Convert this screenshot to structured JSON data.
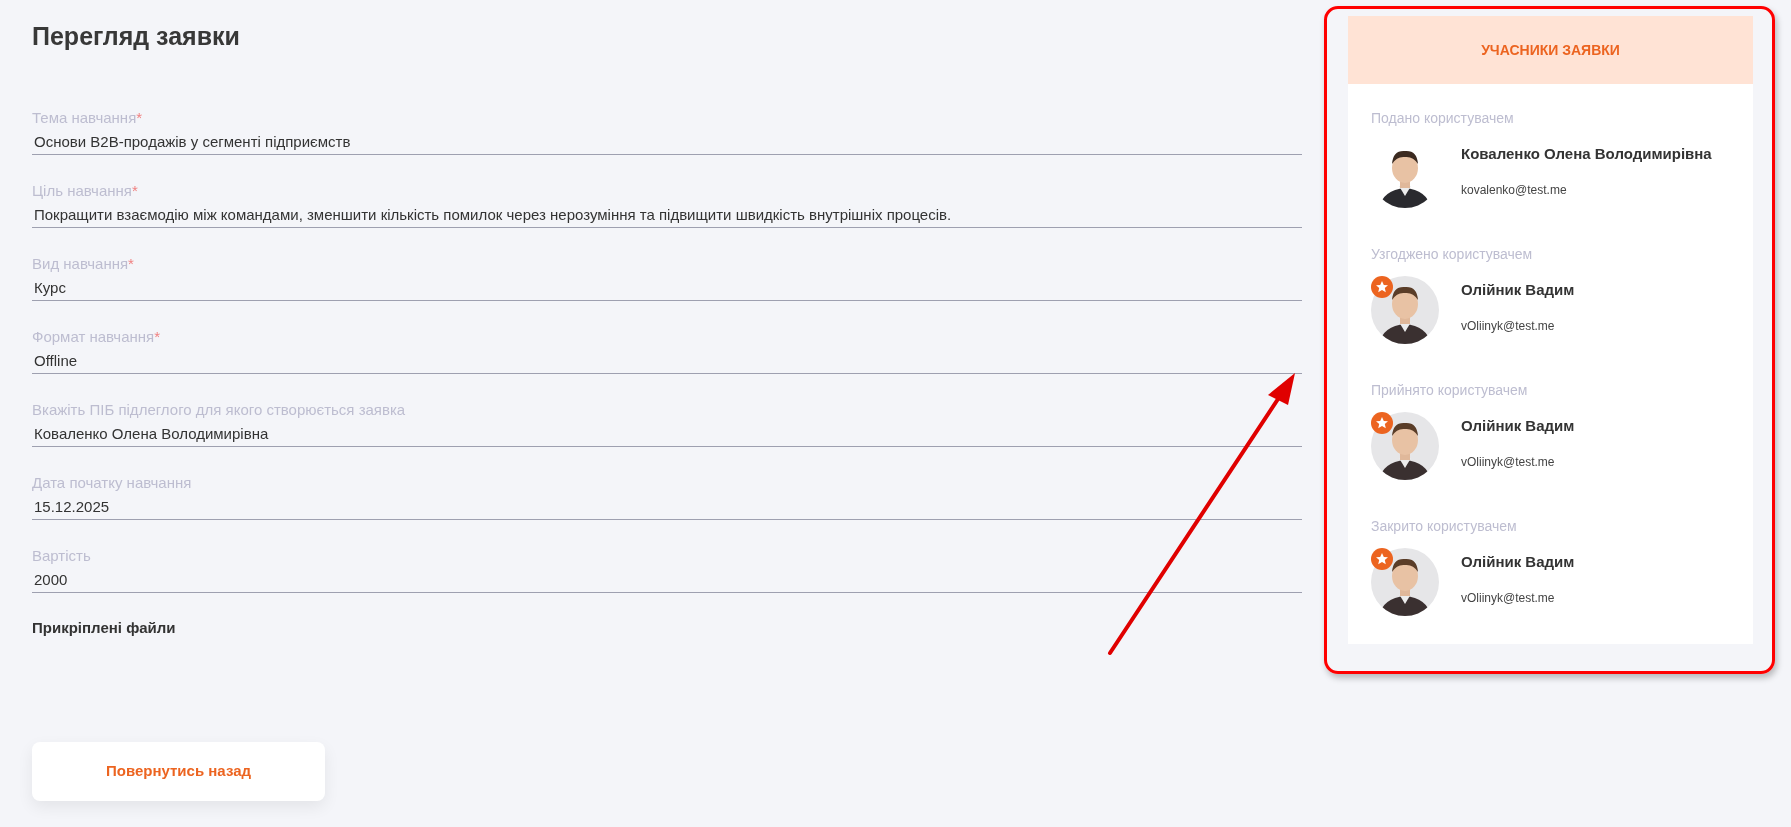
{
  "title": "Перегляд заявки",
  "fields": [
    {
      "label": "Тема навчання",
      "required_mark": "*",
      "value": "Основи B2B-продажів у сегменті підприємств"
    },
    {
      "label": "Ціль навчання",
      "required_mark": "*",
      "value": "Покращити взаємодію між командами, зменшити кількість помилок через нерозуміння та підвищити швидкість внутрішніх процесів."
    },
    {
      "label": "Вид навчання",
      "required_mark": "*",
      "value": "Курс"
    },
    {
      "label": "Формат навчання",
      "required_mark": "*",
      "value": "Offline"
    },
    {
      "label": "Вкажіть ПІБ підлеглого для якого створюється заявка",
      "value": "Коваленко Олена Володимирівна"
    },
    {
      "label": "Дата початку навчання",
      "value": "15.12.2025"
    },
    {
      "label": "Вартість",
      "value": "2000"
    }
  ],
  "attachments_heading": "Прикріплені файли",
  "back_button": "Повернутись назад",
  "participants": {
    "title": "УЧАСНИКИ ЗАЯВКИ",
    "sections": [
      {
        "label": "Подано користувачем",
        "name": "Коваленко Олена Володимирівна",
        "email": "kovalenko@test.me",
        "badge": false
      },
      {
        "label": "Узгоджено користувачем",
        "name": "Олійник Вадим",
        "email": "vOliinyk@test.me",
        "badge": true
      },
      {
        "label": "Прийнято користувачем",
        "name": "Олійник Вадим",
        "email": "vOliinyk@test.me",
        "badge": true
      },
      {
        "label": "Закрито користувачем",
        "name": "Олійник Вадим",
        "email": "vOliinyk@test.me",
        "badge": true
      }
    ]
  }
}
